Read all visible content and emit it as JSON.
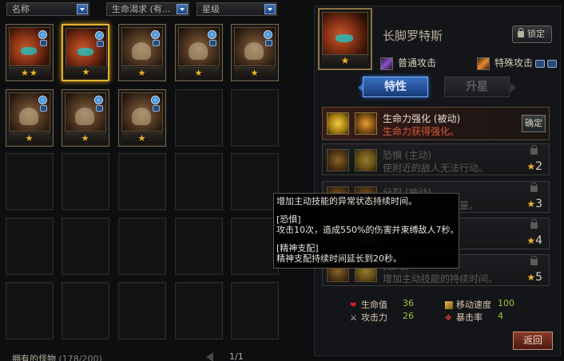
{
  "filters": {
    "sort_name": "名称",
    "sort_attr": "生命渴求 (有...",
    "sort_star": "星级"
  },
  "grid": {
    "monsters": [
      {
        "stars": "★★",
        "variant": "red"
      },
      {
        "stars": "★",
        "variant": "red",
        "selected": true
      },
      {
        "stars": "★",
        "variant": "brown"
      },
      {
        "stars": "★",
        "variant": "brown"
      },
      {
        "stars": "★",
        "variant": "brown"
      },
      {
        "stars": "★",
        "variant": "brown"
      },
      {
        "stars": "★",
        "variant": "brown"
      },
      {
        "stars": "★",
        "variant": "brown"
      }
    ],
    "owned_label": "拥有的怪物",
    "owned_count": "(178/200)",
    "page": "1/1"
  },
  "hero": {
    "name": "长脚罗特斯",
    "star": "★",
    "lock_label": "锁定",
    "normal_attack": "普通攻击",
    "special_attack": "特殊攻击"
  },
  "tabs": [
    {
      "label": "特性",
      "active": true
    },
    {
      "label": "升星",
      "active": false
    }
  ],
  "skills": [
    {
      "title": "生命力强化 (被动)",
      "desc": "生命力获得强化。",
      "action": "确定"
    },
    {
      "title": "恐惧 (主动)",
      "desc": "使附近的敌人无法行动。",
      "level": "2"
    },
    {
      "title": "分裂 (被动)",
      "desc": "增加召唤的触手数量。",
      "level": "3"
    },
    {
      "title": "",
      "desc": "",
      "level": "4"
    },
    {
      "title": "(被动)",
      "desc": "增加主动技能的持续时间。",
      "level": "5"
    }
  ],
  "tooltip": {
    "line1": "增加主动技能的异常状态持续时间。",
    "h2": "[恐惧]",
    "line2": "攻击10次，造成550%的伤害并束缚敌人7秒。",
    "h3": "[精神支配]",
    "line3": "精神支配持续时间延长到20秒。"
  },
  "stats": {
    "hp_label": "生命值",
    "hp": "36",
    "speed_label": "移动速度",
    "speed": "100",
    "atk_label": "攻击力",
    "atk": "26",
    "crit_label": "暴击率",
    "crit": "4"
  },
  "back_label": "返回",
  "colors": {
    "accent_gold": "#e3b430",
    "tab_blue": "#3a70c0",
    "stat_green": "#9ac83a",
    "star": "#f0b428"
  }
}
